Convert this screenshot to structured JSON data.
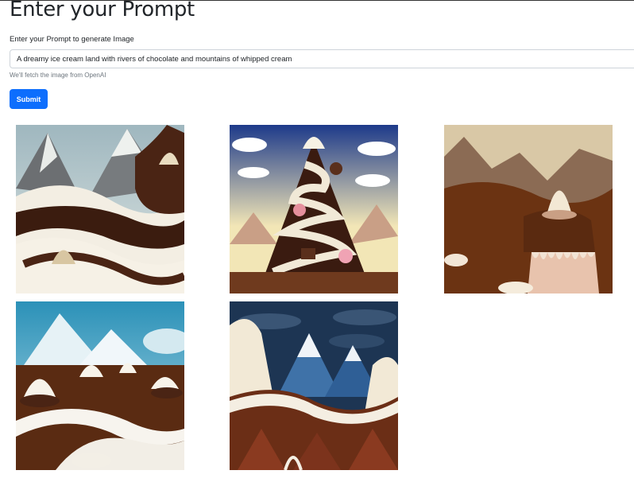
{
  "page": {
    "title": "Enter your Prompt",
    "prompt_label": "Enter your Prompt to generate Image",
    "prompt_value": "A dreamy ice cream land with rivers of chocolate and mountains of whipped cream",
    "help_text": "We'll fetch the image from OpenAI",
    "submit_label": "Submit"
  },
  "colors": {
    "button": "#0d6efd",
    "chocolate": "#4a2414",
    "cream": "#f4efe2"
  },
  "images": [
    {
      "name": "generated-image-1"
    },
    {
      "name": "generated-image-2"
    },
    {
      "name": "generated-image-3"
    },
    {
      "name": "generated-image-4"
    },
    {
      "name": "generated-image-5"
    }
  ]
}
